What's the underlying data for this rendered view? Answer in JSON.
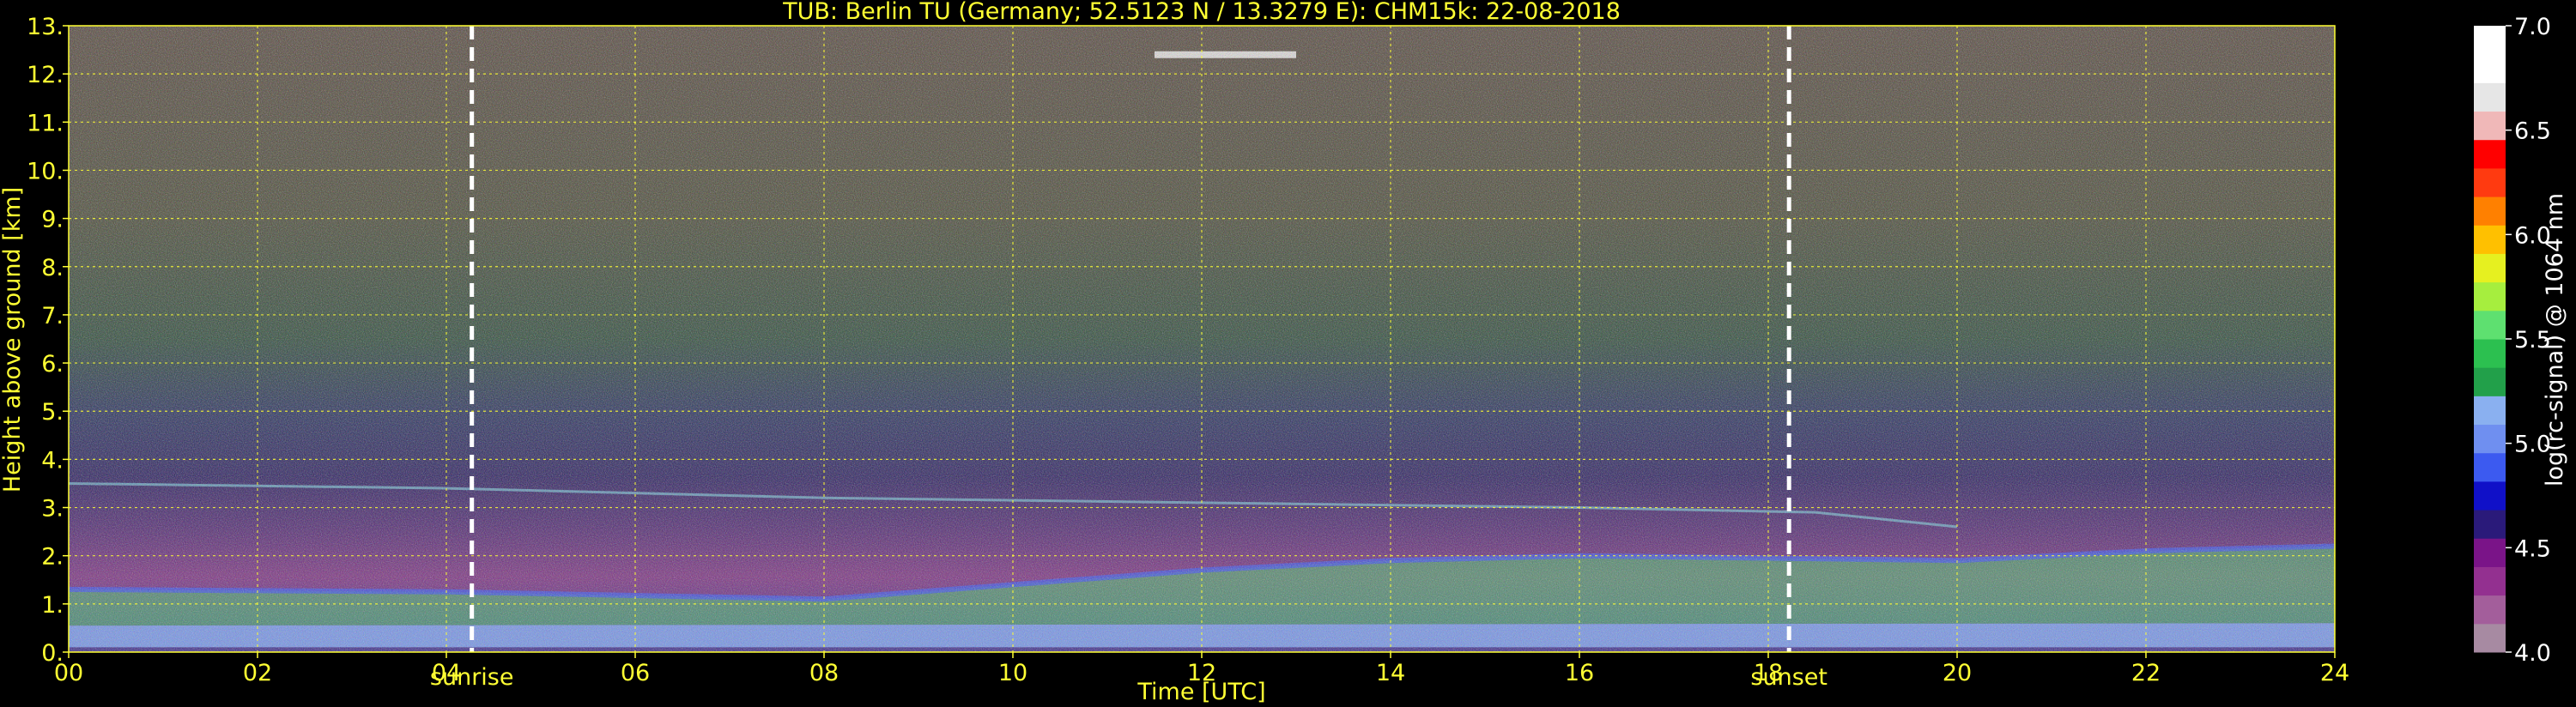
{
  "chart_data": {
    "type": "heatmap",
    "title": "TUB: Berlin TU (Germany; 52.5123 N / 13.3279 E):    CHM15k: 22-08-2018",
    "xlabel": "Time [UTC]",
    "ylabel": "Height above ground [km]",
    "xlim": [
      0,
      24
    ],
    "ylim": [
      0,
      13
    ],
    "x_ticks": [
      0,
      2,
      4,
      6,
      8,
      10,
      12,
      14,
      16,
      18,
      20,
      22,
      24
    ],
    "x_tick_labels": [
      "00",
      "02",
      "04",
      "06",
      "08",
      "10",
      "12",
      "14",
      "16",
      "18",
      "20",
      "22",
      "24"
    ],
    "y_ticks": [
      0,
      1,
      2,
      3,
      4,
      5,
      6,
      7,
      8,
      9,
      10,
      11,
      12,
      13
    ],
    "y_tick_labels": [
      "0.",
      "1.",
      "2.",
      "3.",
      "4.",
      "5.",
      "6.",
      "7.",
      "8.",
      "9.",
      "10.",
      "11.",
      "12.",
      "13."
    ],
    "grid": true,
    "events": [
      {
        "label": "sunrise",
        "x": 4.27
      },
      {
        "label": "sunset",
        "x": 18.22
      }
    ],
    "colorbar": {
      "label": "log(rc-signal) @ 1064 nm",
      "range": [
        4.0,
        7.0
      ],
      "ticks": [
        4.0,
        4.5,
        5.0,
        5.5,
        6.0,
        6.5,
        7.0
      ],
      "tick_labels": [
        "4.0",
        "4.5",
        "5.0",
        "5.5",
        "6.0",
        "6.5",
        "7.0"
      ],
      "colors": [
        "#a78aa2",
        "#a35e9b",
        "#933090",
        "#7a1488",
        "#2a1a7a",
        "#1010c8",
        "#3c5af0",
        "#6f8ff0",
        "#8ab0f0",
        "#22a04a",
        "#2cc050",
        "#5ee070",
        "#a6ee3e",
        "#e6f020",
        "#ffc000",
        "#ff8000",
        "#ff3a10",
        "#ff0000",
        "#f0b8b8",
        "#e6e6e6",
        "#ffffff",
        "#ffffff"
      ]
    },
    "layers": [
      {
        "name": "surface aerosol",
        "x": [
          0,
          24
        ],
        "y_bottom": [
          0.1,
          0.1
        ],
        "y_top": [
          0.55,
          0.6
        ]
      },
      {
        "name": "boundary layer top",
        "x": [
          0,
          4,
          8,
          10,
          12,
          14,
          16,
          18,
          20,
          22,
          24
        ],
        "y": [
          1.3,
          1.25,
          1.1,
          1.4,
          1.7,
          1.9,
          2.0,
          1.95,
          1.9,
          2.1,
          2.2
        ]
      },
      {
        "name": "elevated layer",
        "x": [
          0,
          4,
          8,
          12,
          16,
          18.5,
          20
        ],
        "y": [
          3.5,
          3.4,
          3.2,
          3.1,
          3.0,
          2.9,
          2.6
        ]
      },
      {
        "name": "cloud",
        "x": [
          11.5,
          13.0
        ],
        "y": [
          12.4,
          12.4
        ]
      }
    ]
  }
}
